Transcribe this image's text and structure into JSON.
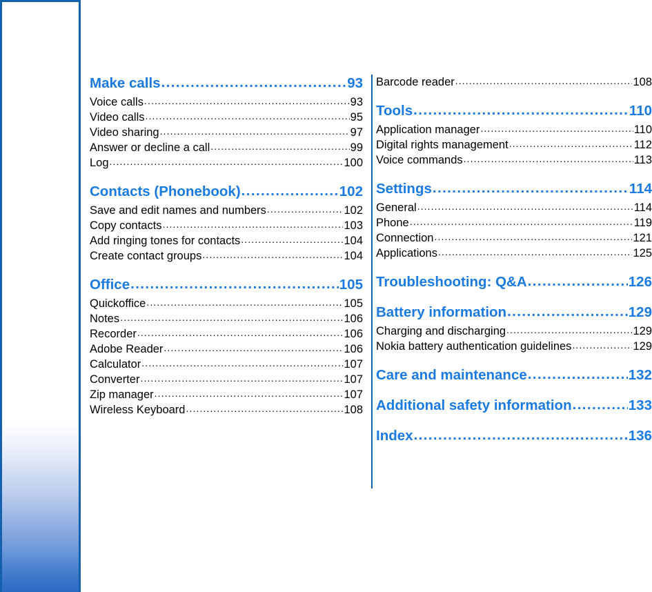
{
  "colors": {
    "heading_blue": "#1a7ae0",
    "rule_blue": "#1560ad",
    "body_black": "#000000",
    "sidebar_gradient_end": "#2a6cc4"
  },
  "leader": "......................................................................................................",
  "columns": {
    "left": [
      {
        "type": "section",
        "label": "Make calls",
        "page": "93",
        "entries": [
          {
            "label": "Voice calls",
            "page": "93"
          },
          {
            "label": "Video calls",
            "page": "95"
          },
          {
            "label": "Video sharing",
            "page": "97"
          },
          {
            "label": "Answer or decline a call",
            "page": "99"
          },
          {
            "label": "Log ",
            "page": "100"
          }
        ]
      },
      {
        "type": "section",
        "label": "Contacts (Phonebook) ",
        "page": "102",
        "entries": [
          {
            "label": "Save and edit names and numbers",
            "page": "102"
          },
          {
            "label": "Copy contacts ",
            "page": "103"
          },
          {
            "label": "Add ringing tones for contacts",
            "page": "104"
          },
          {
            "label": "Create contact groups",
            "page": "104"
          }
        ]
      },
      {
        "type": "section",
        "label": "Office",
        "page": "105",
        "entries": [
          {
            "label": "Quickoffice ",
            "page": "105"
          },
          {
            "label": "Notes ",
            "page": "106"
          },
          {
            "label": "Recorder ",
            "page": "106"
          },
          {
            "label": "Adobe Reader ",
            "page": "106"
          },
          {
            "label": "Calculator ",
            "page": "107"
          },
          {
            "label": "Converter ",
            "page": "107"
          },
          {
            "label": "Zip manager ",
            "page": "107"
          },
          {
            "label": "Wireless Keyboard ",
            "page": "108"
          }
        ]
      }
    ],
    "right": [
      {
        "type": "orphan",
        "entries": [
          {
            "label": "Barcode reader ",
            "page": "108"
          }
        ]
      },
      {
        "type": "section",
        "label": "Tools",
        "page": "110",
        "entries": [
          {
            "label": "Application manager ",
            "page": "110"
          },
          {
            "label": "Digital rights management ",
            "page": "112"
          },
          {
            "label": "Voice commands ",
            "page": "113"
          }
        ]
      },
      {
        "type": "section",
        "label": "Settings ",
        "page": "114",
        "entries": [
          {
            "label": "General ",
            "page": "114"
          },
          {
            "label": "Phone ",
            "page": "119"
          },
          {
            "label": "Connection ",
            "page": "121"
          },
          {
            "label": "Applications ",
            "page": "125"
          }
        ]
      },
      {
        "type": "section",
        "label": "Troubleshooting: Q&A ",
        "page": "126",
        "entries": []
      },
      {
        "type": "section",
        "label": "Battery information ",
        "page": "129",
        "entries": [
          {
            "label": "Charging and discharging",
            "page": "129"
          },
          {
            "label": "Nokia battery authentication guidelines ",
            "page": "129"
          }
        ]
      },
      {
        "type": "section",
        "label": "Care and maintenance ",
        "page": "132",
        "entries": []
      },
      {
        "type": "section",
        "label": "Additional safety information",
        "page": "133",
        "entries": []
      },
      {
        "type": "section",
        "label": "Index ",
        "page": "136",
        "entries": []
      }
    ]
  }
}
